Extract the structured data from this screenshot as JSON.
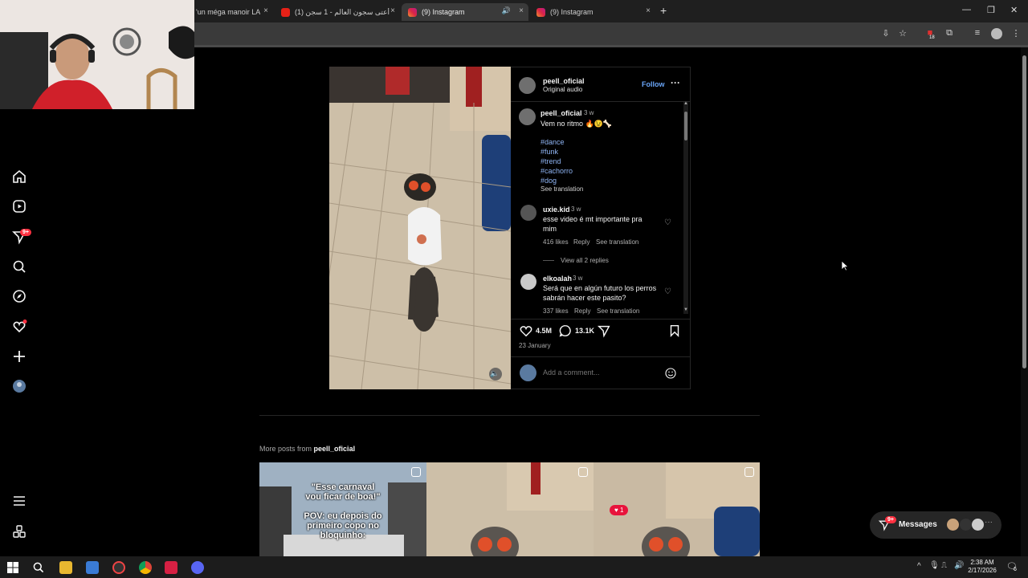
{
  "browser": {
    "tabs": [
      {
        "label": "'un méga manoir LA",
        "close": "×"
      },
      {
        "label": "(1) أعتى سجون العالم - 1 سجن ..",
        "close": "×"
      },
      {
        "label": "(9) Instagram",
        "close": "×"
      },
      {
        "label": "(9) Instagram",
        "close": "×"
      }
    ],
    "new_tab": "+",
    "window_controls": {
      "minimize": "—",
      "maximize": "❐",
      "close": "✕"
    },
    "extension_badge": "18"
  },
  "nav": {
    "notifications_badge": "9+"
  },
  "post": {
    "author": "peell_oficial",
    "audio": "Original audio",
    "follow_label": "Follow",
    "more_label": "···",
    "caption": {
      "username": "peell_oficial",
      "time": "3 w",
      "text": "Vem no ritmo 🔥😉🦴",
      "hashtags": [
        "#dance",
        "#funk",
        "#trend",
        "#cachorro",
        "#dog"
      ],
      "see_translation": "See translation"
    },
    "comments": [
      {
        "username": "uxie.kid",
        "time": "3 w",
        "text": "esse video é mt importante pra mim",
        "likes": "416 likes",
        "reply": "Reply",
        "see_translation": "See translation",
        "view_replies": "View all 2 replies"
      },
      {
        "username": "elkoalah",
        "time": "3 w",
        "text": "Será que en algún futuro los perros sabrán hacer este pasito?",
        "likes": "337 likes",
        "reply": "Reply",
        "see_translation": "See translation"
      }
    ],
    "like_count": "4.5M",
    "comment_count": "13.1K",
    "date": "23 January",
    "add_comment_placeholder": "Add a comment..."
  },
  "more_posts": {
    "prefix": "More posts from",
    "username": "peell_oficial",
    "thumbs": [
      {
        "overlay_line1": "\"Esse carnaval",
        "overlay_line2": "vou ficar de boa!\"",
        "overlay_line3": "POV: eu depois do",
        "overlay_line4": "primeiro copo no",
        "overlay_line5": "bloquinho:"
      },
      {},
      {
        "heart_count": "1"
      }
    ]
  },
  "messages": {
    "label": "Messages",
    "badge": "9+"
  },
  "taskbar": {
    "time": "2:38 AM",
    "date": "2/17/2026",
    "notif_count": "6"
  }
}
